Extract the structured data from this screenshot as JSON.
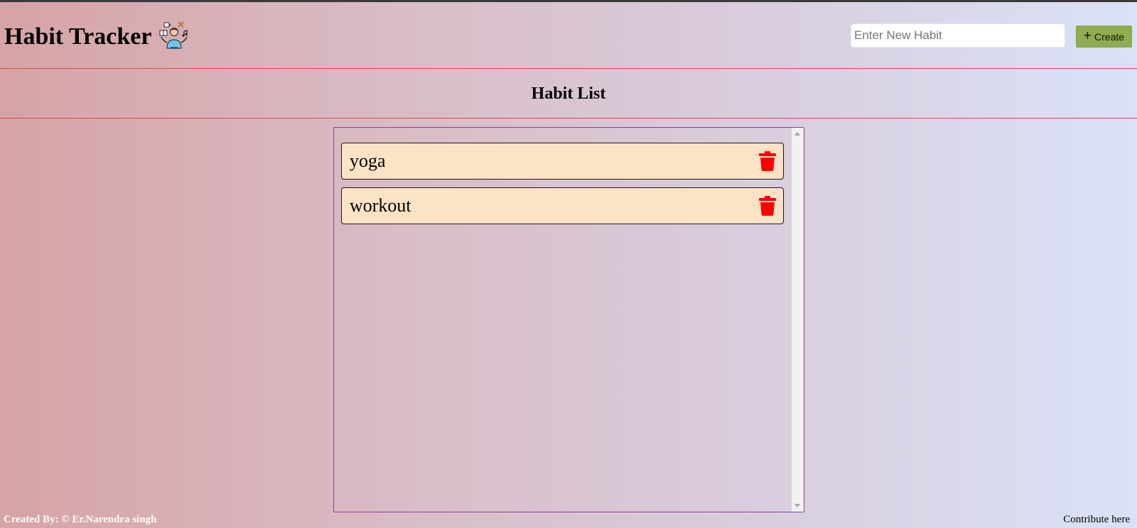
{
  "header": {
    "title": "Habit Tracker",
    "logo_icon": "person-multitasking-icon",
    "input_placeholder": "Enter New Habit",
    "input_value": "",
    "create_icon": "plus-icon",
    "create_label": "Create",
    "create_button_color": "#8fac4e"
  },
  "main": {
    "section_title": "Habit List",
    "habits": [
      {
        "name": "yoga",
        "delete_icon": "trash-icon"
      },
      {
        "name": "workout",
        "delete_icon": "trash-icon"
      }
    ],
    "item_background": "#fde3c5",
    "delete_icon_color": "#ff0000",
    "panel_border_color": "#8d3a9e",
    "divider_color": "#e04848"
  },
  "footer": {
    "credit": "Created By: © Er.Narendra singh",
    "contribute_label": "Contribute here"
  }
}
